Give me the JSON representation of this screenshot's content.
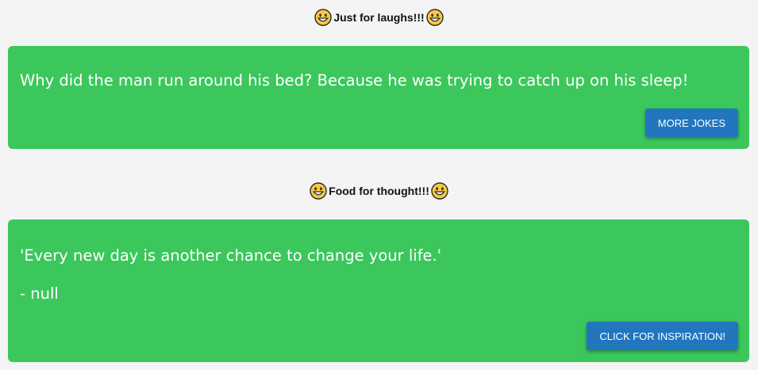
{
  "jokes": {
    "heading": "Just for laughs!!!",
    "left_icon": "smiley-face-icon",
    "right_icon": "smiley-face-icon",
    "joke_text": "Why did the man run around his bed? Because he was trying to catch up on his sleep!",
    "button_label": "MORE JOKES",
    "card_color": "#3cc75c",
    "button_color": "#2176bd"
  },
  "quotes": {
    "heading": "Food for thought!!!",
    "left_icon": "smiley-face-icon",
    "right_icon": "smiley-face-icon",
    "quote_text": "'Every new day is another chance to change your life.'",
    "author_text": "- null",
    "button_label": "CLICK FOR INSPIRATION!",
    "card_color": "#3cc75c",
    "button_color": "#2176bd"
  }
}
